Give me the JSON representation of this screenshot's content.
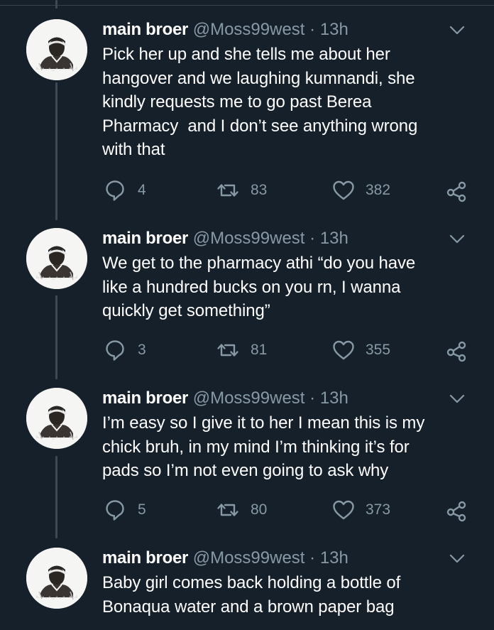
{
  "colors": {
    "background": "#15202b",
    "text_primary": "#ffffff",
    "text_secondary": "#8899a6",
    "thread_line": "#3d4a55"
  },
  "icons": {
    "reply": "reply-icon",
    "retweet": "retweet-icon",
    "like": "like-icon",
    "share": "share-icon",
    "menu": "chevron-down-icon"
  },
  "tweets": [
    {
      "author_name": "main broer",
      "handle": "@Moss99west",
      "separator": "·",
      "time": "13h",
      "text": "Pick her up and she tells me about her\nhangover and we laughing kumnandi, she\nkindly requests me to go past Berea\nPharmacy  and I don’t see anything wrong\nwith that",
      "replies": "4",
      "retweets": "83",
      "likes": "382"
    },
    {
      "author_name": "main broer",
      "handle": "@Moss99west",
      "separator": "·",
      "time": "13h",
      "text": "We get to the pharmacy athi “do you have\nlike a hundred bucks on you rn, I wanna\nquickly get something”",
      "replies": "3",
      "retweets": "81",
      "likes": "355"
    },
    {
      "author_name": "main broer",
      "handle": "@Moss99west",
      "separator": "·",
      "time": "13h",
      "text": "I’m easy so I give it to her I mean this is my\nchick bruh, in my mind I’m thinking it’s for\npads so I’m not even going to ask why",
      "replies": "5",
      "retweets": "80",
      "likes": "373"
    },
    {
      "author_name": "main broer",
      "handle": "@Moss99west",
      "separator": "·",
      "time": "13h",
      "text": "Baby girl comes back holding a bottle of\nBonaqua water and a brown paper bag"
    }
  ]
}
